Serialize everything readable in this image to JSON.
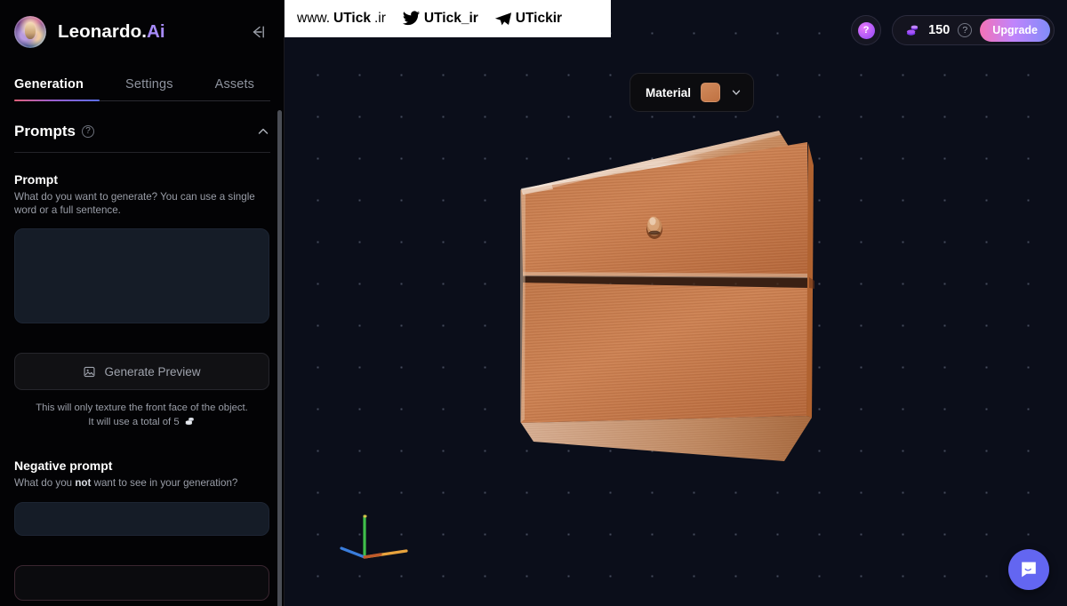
{
  "sidebar": {
    "brand": {
      "name": "Leonardo.",
      "suffix": "Ai"
    },
    "collapse_icon": "collapse-sidebar-icon",
    "tabs": [
      {
        "label": "Generation",
        "active": true
      },
      {
        "label": "Settings",
        "active": false
      },
      {
        "label": "Assets",
        "active": false
      }
    ],
    "section": {
      "title": "Prompts",
      "help_icon": "?",
      "collapse_chevron": "chevron-up-icon"
    },
    "prompt": {
      "label": "Prompt",
      "description": "What do you want to generate? You can use a single word or a full sentence.",
      "value": "",
      "placeholder": ""
    },
    "generate_button": {
      "label": "Generate Preview",
      "icon": "image-generate-icon"
    },
    "note": {
      "line1": "This will only texture the front face of the object.",
      "line2": "It will use a total of 5",
      "coin_icon": "credits-coins-icon"
    },
    "negative_prompt": {
      "label": "Negative prompt",
      "desc_pre": "What do you ",
      "desc_bold": "not",
      "desc_post": " want to see in your generation?",
      "value": "",
      "placeholder": ""
    }
  },
  "topbar": {
    "help_button": {
      "icon": "help-question-icon",
      "label": "?"
    },
    "credits": {
      "icon": "credits-coins-icon",
      "amount": "150",
      "help_label": "?"
    },
    "upgrade_button": {
      "label": "Upgrade"
    }
  },
  "watermark": {
    "items": [
      {
        "icon": "",
        "lite": "www.",
        "bold": "UTick",
        "tail": ".ir"
      },
      {
        "icon": "twitter-bird-icon",
        "lite": "",
        "bold": "UTick_ir",
        "tail": ""
      },
      {
        "icon": "telegram-plane-icon",
        "lite": "",
        "bold": "UTickir",
        "tail": ""
      }
    ]
  },
  "viewport": {
    "material_control": {
      "label": "Material",
      "swatch_color": "#c8794b",
      "chevron_icon": "chevron-down-icon"
    },
    "model": {
      "name": "wooden-box-3d-model",
      "front_color": "#c67a4a",
      "side_color": "#b9622f",
      "top_color": "#caa07a"
    },
    "axis_gizmo": {
      "x_color": "#e8a33d",
      "y_color": "#3fbf4a",
      "z_color": "#3a7ddc"
    },
    "background_color": "#0b0e1a",
    "dot_grid_color": "#8e97b2"
  },
  "chat_launcher": {
    "icon": "chat-bubble-icon"
  }
}
